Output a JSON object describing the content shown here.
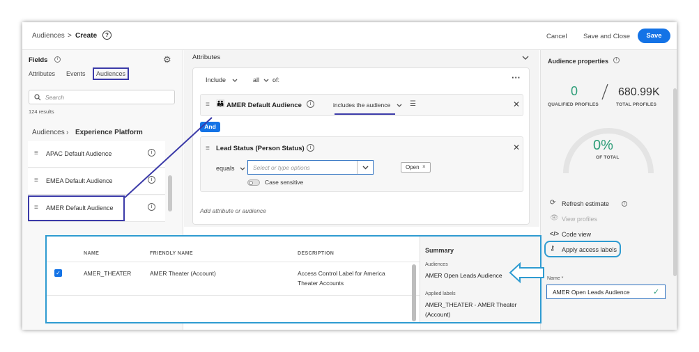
{
  "header": {
    "breadcrumb_root": "Audiences",
    "breadcrumb_sep": ">",
    "breadcrumb_current": "Create",
    "cancel_label": "Cancel",
    "save_close_label": "Save and Close",
    "save_label": "Save"
  },
  "fields_panel": {
    "title": "Fields",
    "tabs": [
      "Attributes",
      "Events",
      "Audiences"
    ],
    "search_placeholder": "Search",
    "results": "124 results",
    "path_root": "Audiences",
    "path_current": "Experience Platform",
    "items": [
      "APAC Default Audience",
      "EMEA Default Audience",
      "AMER Default Audience"
    ]
  },
  "builder": {
    "section_title": "Attributes",
    "include_label": "Include",
    "all_label": "all",
    "of_label": "of:",
    "rule1_name": "AMER Default Audience",
    "rule1_operator": "includes the audience",
    "and_label": "And",
    "rule2_name": "Lead Status (Person Status)",
    "rule2_operator": "equals",
    "rule2_placeholder": "Select or type options",
    "rule2_tag": "Open",
    "case_sensitive_label": "Case sensitive",
    "add_label": "Add attribute or audience"
  },
  "properties": {
    "title": "Audience properties",
    "qualified_value": "0",
    "qualified_label": "QUALIFIED PROFILES",
    "total_value": "680.99K",
    "total_label": "TOTAL PROFILES",
    "percent_value": "0%",
    "percent_label": "OF TOTAL",
    "percent_fraction": 0,
    "refresh_label": "Refresh estimate",
    "view_profiles_label": "View profiles",
    "code_view_label": "Code view",
    "apply_labels_label": "Apply access labels",
    "name_label": "Name *",
    "name_value": "AMER Open Leads Audience"
  },
  "labels_dialog": {
    "columns": [
      "NAME",
      "FRIENDLY NAME",
      "DESCRIPTION"
    ],
    "rows": [
      {
        "name": "AMER_THEATER",
        "friendly": "AMER Theater (Account)",
        "description_line1": "Access Control Label for America",
        "description_line2": "Theater Accounts"
      }
    ],
    "summary_title": "Summary",
    "audiences_label": "Audiences",
    "audience_value": "AMER Open Leads Audience",
    "applied_label": "Applied labels",
    "applied_value_line1": "AMER_THEATER - AMER Theater",
    "applied_value_line2": "(Account)"
  },
  "colors": {
    "accent": "#1473e6",
    "highlight_dark": "#3b3aa8",
    "highlight_light": "#2e9bd1",
    "positive": "#2d9d78"
  }
}
